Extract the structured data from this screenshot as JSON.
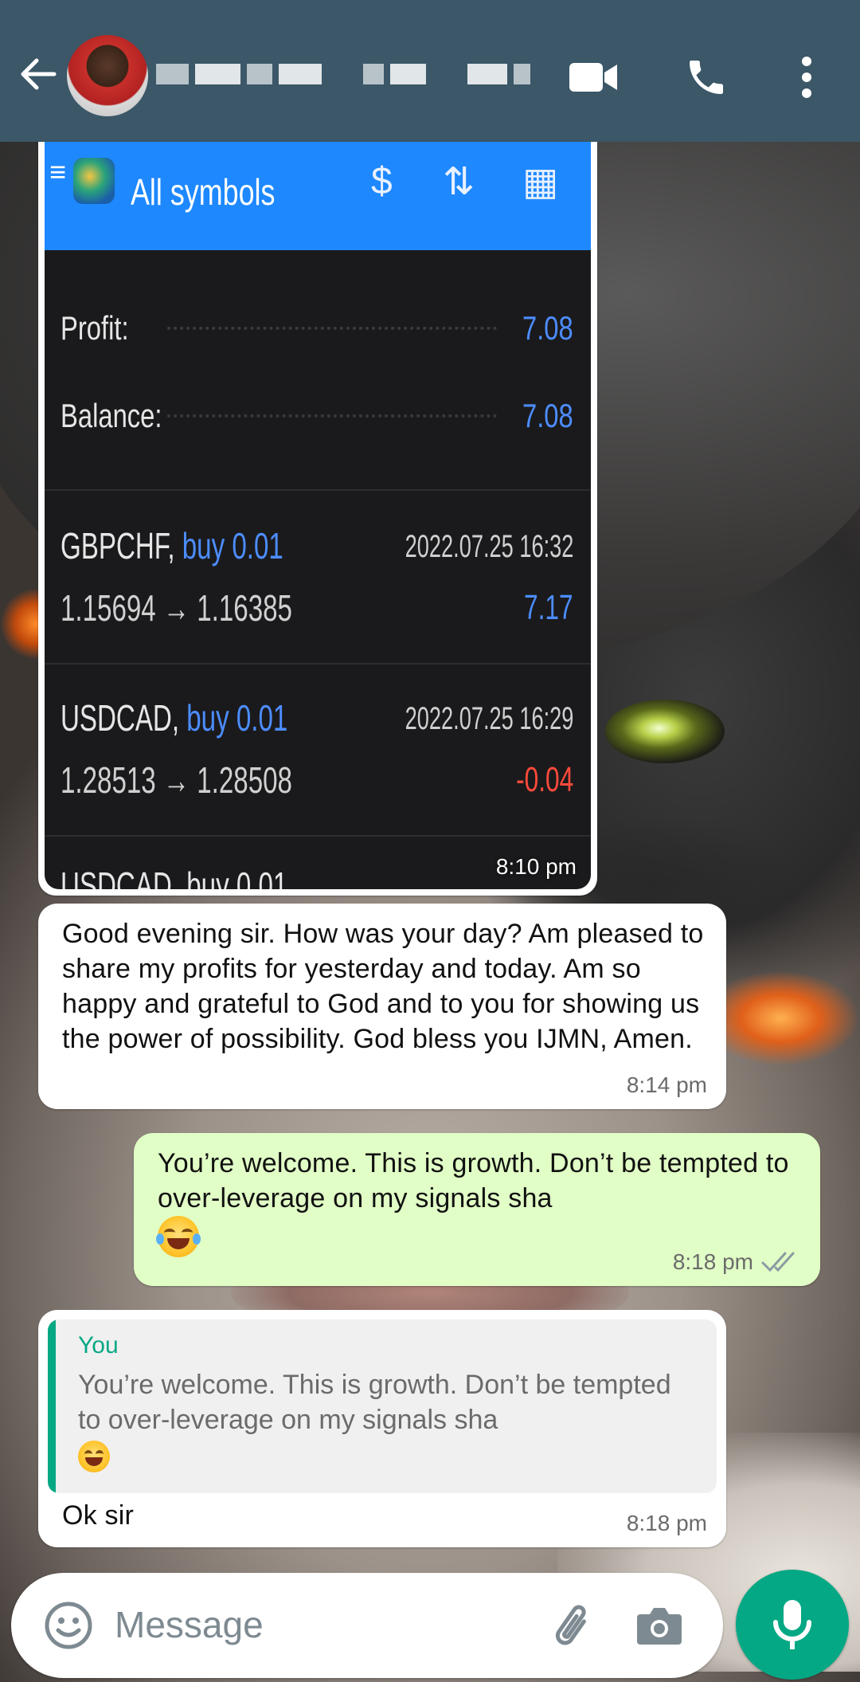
{
  "header": {
    "contact_name": "",
    "icons": [
      "back-arrow-icon",
      "video-call-icon",
      "voice-call-icon",
      "overflow-menu-icon"
    ]
  },
  "screenshot": {
    "app_title": "All symbols",
    "profit_label": "Profit:",
    "profit_value": "7.08",
    "balance_label": "Balance:",
    "balance_value": "7.08",
    "trades": [
      {
        "symbol": "GBPCHF,",
        "side": "buy 0.01",
        "date": "2022.07.25 16:32",
        "prices": "1.15694 → 1.16385",
        "pnl": "7.17"
      },
      {
        "symbol": "USDCAD,",
        "side": "buy 0.01",
        "date": "2022.07.25 16:29",
        "prices": "1.28513 → 1.28508",
        "pnl": "-0.04"
      }
    ],
    "partial_row": "USDCAD, buy 0.01",
    "time": "8:10 pm"
  },
  "messages": [
    {
      "direction": "in",
      "text": "Good evening sir. How was your day? Am pleased to share my profits for yesterday and today. Am so happy and grateful to God and to you for showing us the power of possibility. God bless you IJMN, Amen.",
      "time": "8:14 pm"
    },
    {
      "direction": "out",
      "text": "You’re welcome. This is growth. Don’t be tempted to over-leverage on my signals sha",
      "emoji": "😂",
      "time": "8:18 pm",
      "status": "read"
    },
    {
      "direction": "in",
      "quote_author": "You",
      "quote_text": "You’re welcome. This is growth. Don’t be tempted to over-leverage on my signals sha",
      "quote_emoji": "😂",
      "text": "Ok sir",
      "time": "8:18 pm"
    }
  ],
  "composer": {
    "placeholder": "Message",
    "icons": [
      "emoji-icon",
      "attach-icon",
      "camera-icon",
      "mic-icon"
    ]
  },
  "colors": {
    "appbar": "#3b5768",
    "outgoing_bubble": "#e1fec6",
    "accent": "#05a884",
    "broker_bar": "#1e88ff"
  }
}
